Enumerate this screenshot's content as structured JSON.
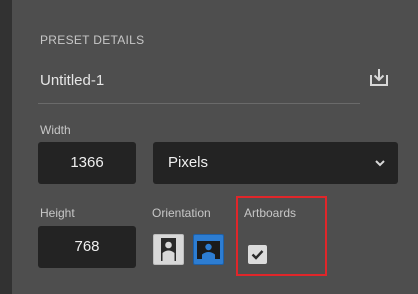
{
  "preset_details": {
    "section_title": "PRESET DETAILS",
    "preset_name": "Untitled-1",
    "save_preset_icon": "save-preset-icon"
  },
  "width": {
    "label": "Width",
    "value": "1366"
  },
  "units": {
    "selected": "Pixels",
    "dropdown_icon": "chevron-down-icon"
  },
  "height": {
    "label": "Height",
    "value": "768"
  },
  "orientation": {
    "label": "Orientation",
    "options": [
      {
        "name": "portrait",
        "icon": "portrait-person-icon",
        "selected": false
      },
      {
        "name": "landscape",
        "icon": "landscape-person-icon",
        "selected": true
      }
    ]
  },
  "artboards": {
    "label": "Artboards",
    "checked": true
  },
  "colors": {
    "accent_blue": "#2d7dd2",
    "highlight_red": "#e0262a",
    "panel_bg": "#4e4e4e",
    "field_bg": "#232323"
  }
}
